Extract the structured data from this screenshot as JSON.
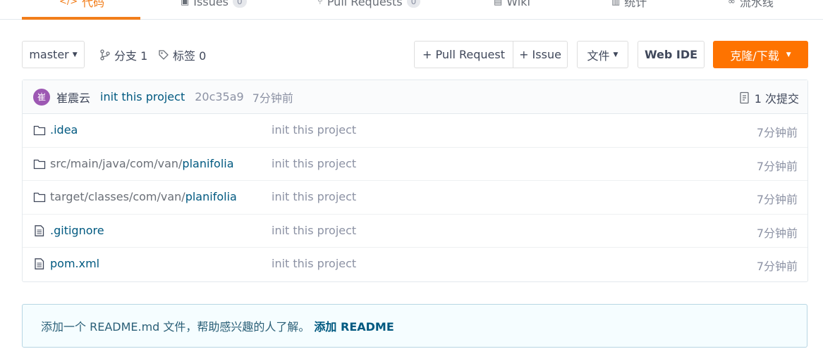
{
  "tabs": [
    {
      "label": "代码",
      "icon": "code-icon",
      "active": true
    },
    {
      "label": "Issues",
      "icon": "issues-icon",
      "badge": "0"
    },
    {
      "label": "Pull Requests",
      "icon": "pull-request-icon",
      "badge": "0"
    },
    {
      "label": "Wiki",
      "icon": "wiki-icon"
    },
    {
      "label": "统计",
      "icon": "stats-icon"
    },
    {
      "label": "流水线",
      "icon": "pipeline-icon"
    }
  ],
  "toolbar": {
    "branch": "master",
    "branches_label": "分支 1",
    "tags_label": "标签 0",
    "new_pr": "+ Pull Request",
    "new_issue": "+ Issue",
    "file_menu": "文件",
    "web_ide": "Web IDE",
    "clone": "克隆/下载"
  },
  "commit": {
    "avatar_text": "崔",
    "author": "崔震云",
    "message": "init this project",
    "sha": "20c35a9",
    "time": "7分钟前",
    "commits_label": "1 次提交"
  },
  "files": [
    {
      "type": "folder",
      "prefix": "",
      "name": ".idea",
      "message": "init this project",
      "time": "7分钟前"
    },
    {
      "type": "folder",
      "prefix": "src/main/java/com/van/",
      "name": "planifolia",
      "message": "init this project",
      "time": "7分钟前"
    },
    {
      "type": "folder",
      "prefix": "target/classes/com/van/",
      "name": "planifolia",
      "message": "init this project",
      "time": "7分钟前"
    },
    {
      "type": "file",
      "prefix": "",
      "name": ".gitignore",
      "message": "init this project",
      "time": "7分钟前"
    },
    {
      "type": "file",
      "prefix": "",
      "name": "pom.xml",
      "message": "init this project",
      "time": "7分钟前"
    }
  ],
  "readme": {
    "text": "添加一个 README.md 文件，帮助感兴趣的人了解。",
    "action": "添加 README"
  },
  "colors": {
    "accent": "#f27e1b",
    "clone_button": "#fe7300",
    "link": "#005980",
    "avatar": "#9d58b3"
  }
}
